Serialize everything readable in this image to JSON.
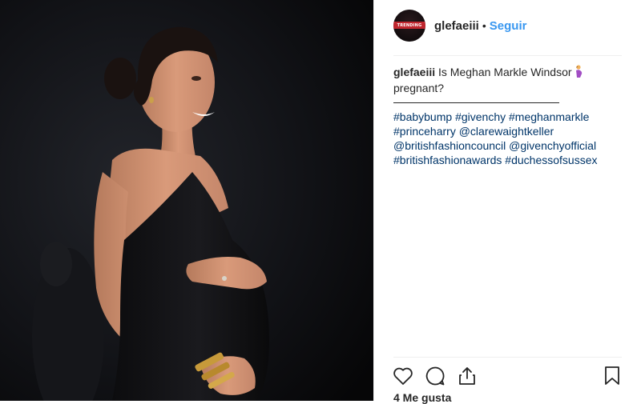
{
  "post": {
    "username": "glefaeiii",
    "separator": "•",
    "follow_label": "Seguir",
    "avatar_text": "TRENDING",
    "caption": {
      "username": "glefaeiii",
      "text": "Is Meghan Markle Windsor",
      "text_line2": "pregnant?",
      "emoji": "pregnant-woman-emoji"
    },
    "hashtags": [
      "#babybump",
      "#givenchy",
      "#meghanmarkle",
      "#princeharry",
      "@clarewaightkeller",
      "@britishfashioncouncil",
      "@givenchyofficial",
      "#britishfashionawards",
      "#duchessofsussex"
    ],
    "likes": "4 Me gusta"
  },
  "icons": {
    "like": "heart-icon",
    "comment": "comment-icon",
    "share": "share-icon",
    "save": "bookmark-icon"
  },
  "colors": {
    "link": "#3897f0",
    "hashtag": "#003569",
    "text": "#262626",
    "photo_bg": "#0b0b0d"
  }
}
